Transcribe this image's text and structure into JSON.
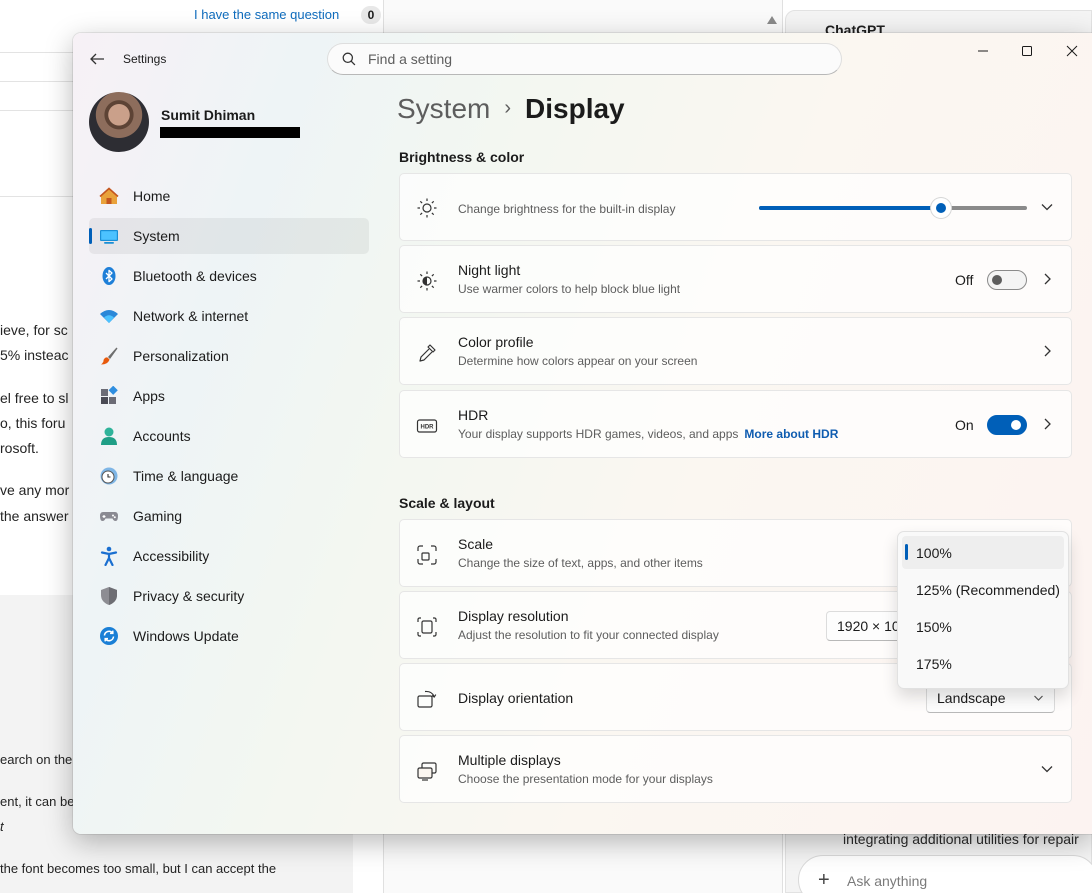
{
  "background": {
    "question_link": "I have the same question",
    "question_count": "0",
    "left_fragments": [
      "ieve, for sc",
      "5% insteac",
      "el free to sl",
      "o, this foru",
      "rosoft.",
      "ve any mor",
      "the answer",
      "earch on the",
      "ent, it can be",
      "t",
      "the font becomes too small, but I can accept the"
    ],
    "chat_title": "ChatGPT",
    "chat_text": "integrating additional utilities for repair",
    "chat_placeholder": "Ask anything"
  },
  "window": {
    "app_title": "Settings",
    "search_placeholder": "Find a setting"
  },
  "profile": {
    "name": "Sumit Dhiman"
  },
  "nav": {
    "items": [
      {
        "label": "Home",
        "icon": "home-icon"
      },
      {
        "label": "System",
        "icon": "system-icon"
      },
      {
        "label": "Bluetooth & devices",
        "icon": "bluetooth-icon"
      },
      {
        "label": "Network & internet",
        "icon": "wifi-icon"
      },
      {
        "label": "Personalization",
        "icon": "brush-icon"
      },
      {
        "label": "Apps",
        "icon": "apps-icon"
      },
      {
        "label": "Accounts",
        "icon": "accounts-icon"
      },
      {
        "label": "Time & language",
        "icon": "clock-globe-icon"
      },
      {
        "label": "Gaming",
        "icon": "gamepad-icon"
      },
      {
        "label": "Accessibility",
        "icon": "accessibility-icon"
      },
      {
        "label": "Privacy & security",
        "icon": "shield-icon"
      },
      {
        "label": "Windows Update",
        "icon": "update-icon"
      }
    ],
    "active_index": 1
  },
  "breadcrumb": {
    "parent": "System",
    "separator": "›",
    "current": "Display"
  },
  "brightness_color": {
    "section_title": "Brightness & color",
    "brightness": {
      "label": "Change brightness for the built-in display",
      "level_percent": 68
    },
    "night_light": {
      "title": "Night light",
      "subtitle": "Use warmer colors to help block blue light",
      "state": "Off"
    },
    "color_profile": {
      "title": "Color profile",
      "subtitle": "Determine how colors appear on your screen"
    },
    "hdr": {
      "title": "HDR",
      "subtitle": "Your display supports HDR games, videos, and apps",
      "link": "More about HDR",
      "state": "On"
    }
  },
  "scale_layout": {
    "section_title": "Scale & layout",
    "scale": {
      "title": "Scale",
      "subtitle": "Change the size of text, apps, and other items",
      "options": [
        "100%",
        "125% (Recommended)",
        "150%",
        "175%"
      ],
      "selected_index": 0
    },
    "resolution": {
      "title": "Display resolution",
      "subtitle": "Adjust the resolution to fit your connected display",
      "value": "1920 × 108"
    },
    "orientation": {
      "title": "Display orientation",
      "value": "Landscape"
    },
    "multiple_displays": {
      "title": "Multiple displays",
      "subtitle": "Choose the presentation mode for your displays"
    }
  },
  "colors": {
    "accent": "#005fb8",
    "link": "#0f5cb0"
  }
}
